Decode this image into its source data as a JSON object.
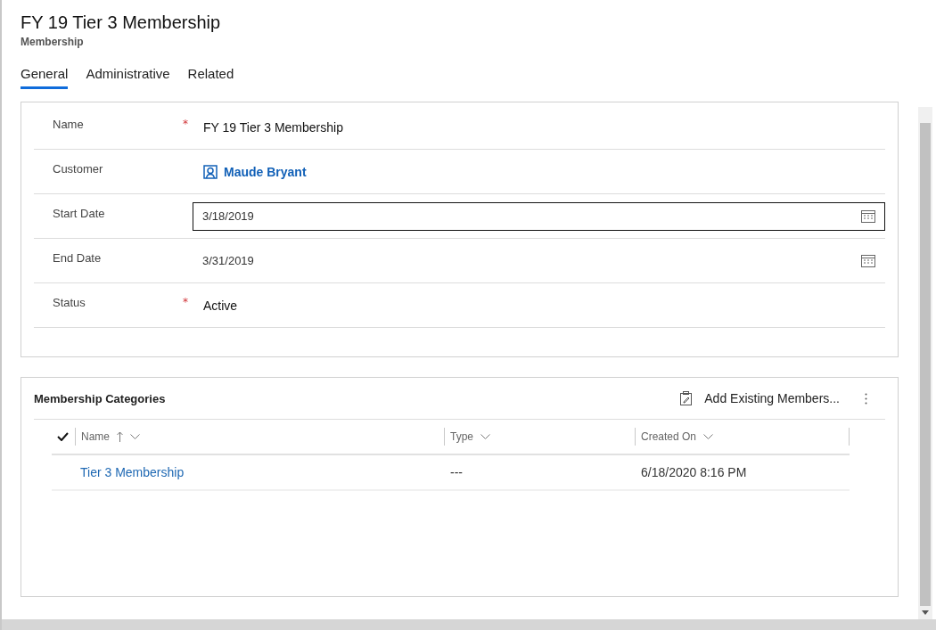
{
  "header": {
    "title": "FY 19 Tier 3 Membership",
    "entity": "Membership"
  },
  "tabs": [
    {
      "label": "General",
      "selected": true
    },
    {
      "label": "Administrative",
      "selected": false
    },
    {
      "label": "Related",
      "selected": false
    }
  ],
  "required_marker": "*",
  "fields": [
    {
      "label": "Name",
      "required": true,
      "kind": "text",
      "value": "FY 19 Tier 3 Membership"
    },
    {
      "label": "Customer",
      "required": false,
      "kind": "lookup",
      "value": "Maude Bryant"
    },
    {
      "label": "Start Date",
      "required": false,
      "kind": "date",
      "value": "3/18/2019",
      "focused": true
    },
    {
      "label": "End Date",
      "required": false,
      "kind": "date",
      "value": "3/31/2019",
      "focused": false
    },
    {
      "label": "Status",
      "required": true,
      "kind": "text",
      "value": "Active"
    }
  ],
  "subgrid": {
    "title": "Membership Categories",
    "command": "Add Existing Members...",
    "columns": [
      {
        "label": "Name",
        "sorted": true
      },
      {
        "label": "Type",
        "sorted": false
      },
      {
        "label": "Created On",
        "sorted": false
      }
    ],
    "rows": [
      {
        "cells": [
          "Tier 3 Membership",
          "---",
          "6/18/2020 8:16 PM"
        ]
      }
    ]
  }
}
